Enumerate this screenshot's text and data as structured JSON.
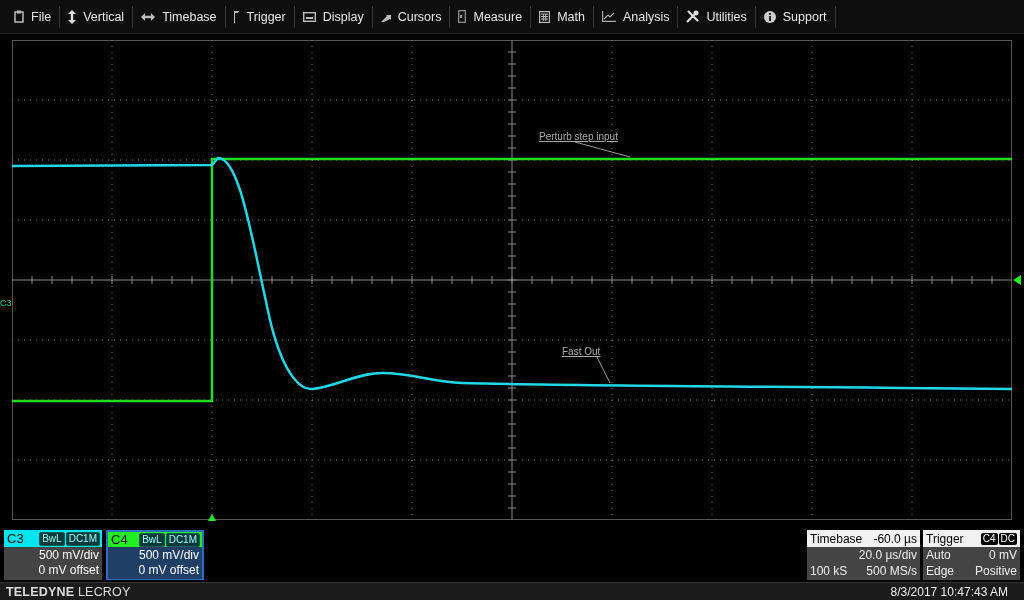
{
  "menu": [
    {
      "label": "File"
    },
    {
      "label": "Vertical"
    },
    {
      "label": "Timebase"
    },
    {
      "label": "Trigger"
    },
    {
      "label": "Display"
    },
    {
      "label": "Cursors"
    },
    {
      "label": "Measure"
    },
    {
      "label": "Math"
    },
    {
      "label": "Analysis"
    },
    {
      "label": "Utilities"
    },
    {
      "label": "Support"
    }
  ],
  "grid": {
    "channel_marker": "C3",
    "annotations": [
      {
        "text": "Perturb step input"
      },
      {
        "text": "Fast Out"
      }
    ]
  },
  "channels": [
    {
      "name": "C3",
      "color": "#00e5f0",
      "selected": false,
      "tags": [
        "BwL",
        "DC1M"
      ],
      "scale": "500 mV/div",
      "offset": "0 mV offset"
    },
    {
      "name": "C4",
      "color": "#22ee22",
      "selected": true,
      "tags": [
        "BwL",
        "DC1M"
      ],
      "scale": "500 mV/div",
      "offset": "0 mV offset"
    }
  ],
  "timebase": {
    "label": "Timebase",
    "delay": "-60.0 µs",
    "scale": "20.0 µs/div",
    "samples": "100 kS",
    "rate": "500 MS/s"
  },
  "trigger": {
    "label": "Trigger",
    "tags": [
      "C4",
      "DC"
    ],
    "mode": "Auto",
    "level": "0 mV",
    "type": "Edge",
    "slope": "Positive"
  },
  "footer": {
    "brand": "**TELEDYNE** LECROY",
    "datetime": "8/3/2017 10:47:43 AM"
  }
}
